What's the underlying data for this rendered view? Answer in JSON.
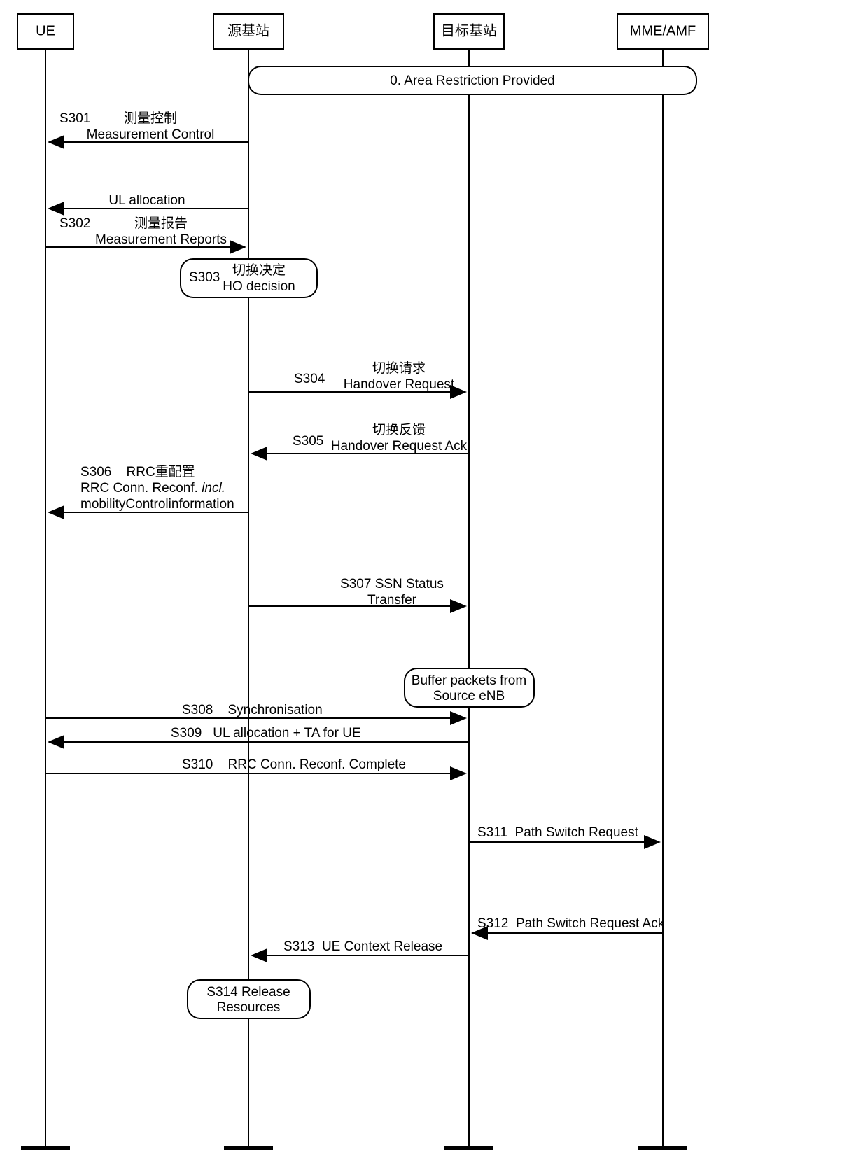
{
  "actors": {
    "ue": "UE",
    "src": "源基站",
    "tgt": "目标基站",
    "mme": "MME/AMF"
  },
  "step0": "0.  Area Restriction Provided",
  "s301": {
    "id": "S301",
    "zh": "测量控制",
    "en": "Measurement Control"
  },
  "ul_alloc": "UL allocation",
  "s302": {
    "id": "S302",
    "zh": "测量报告",
    "en": "Measurement Reports"
  },
  "s303": {
    "id": "S303",
    "zh": "切换决定",
    "en": "HO decision"
  },
  "s304": {
    "id": "S304",
    "zh": "切换请求",
    "en": "Handover Request"
  },
  "s305": {
    "id": "S305",
    "zh": "切换反馈",
    "en": "Handover Request Ack"
  },
  "s306": {
    "id": "S306",
    "zh": "RRC重配置",
    "l2a": "RRC Conn. Reconf. ",
    "l2b": "incl.",
    "l3": "mobilityControlinformation"
  },
  "s307": {
    "id": "S307",
    "l1": "S307 SSN Status",
    "l2": "Transfer"
  },
  "buffer": {
    "l1": "Buffer packets from",
    "l2": "Source eNB"
  },
  "s308": {
    "id": "S308",
    "en": "Synchronisation"
  },
  "s309": {
    "id": "S309",
    "en": "UL allocation   +   TA for UE"
  },
  "s310": {
    "id": "S310",
    "en": "RRC Conn. Reconf. Complete"
  },
  "s311": {
    "id": "S311",
    "en": "Path Switch Request"
  },
  "s312": {
    "id": "S312",
    "en": "Path Switch Request Ack"
  },
  "s313": {
    "id": "S313",
    "en": "UE Context Release"
  },
  "s314": {
    "id": "S314",
    "l1": "S314  Release",
    "l2": "Resources"
  }
}
